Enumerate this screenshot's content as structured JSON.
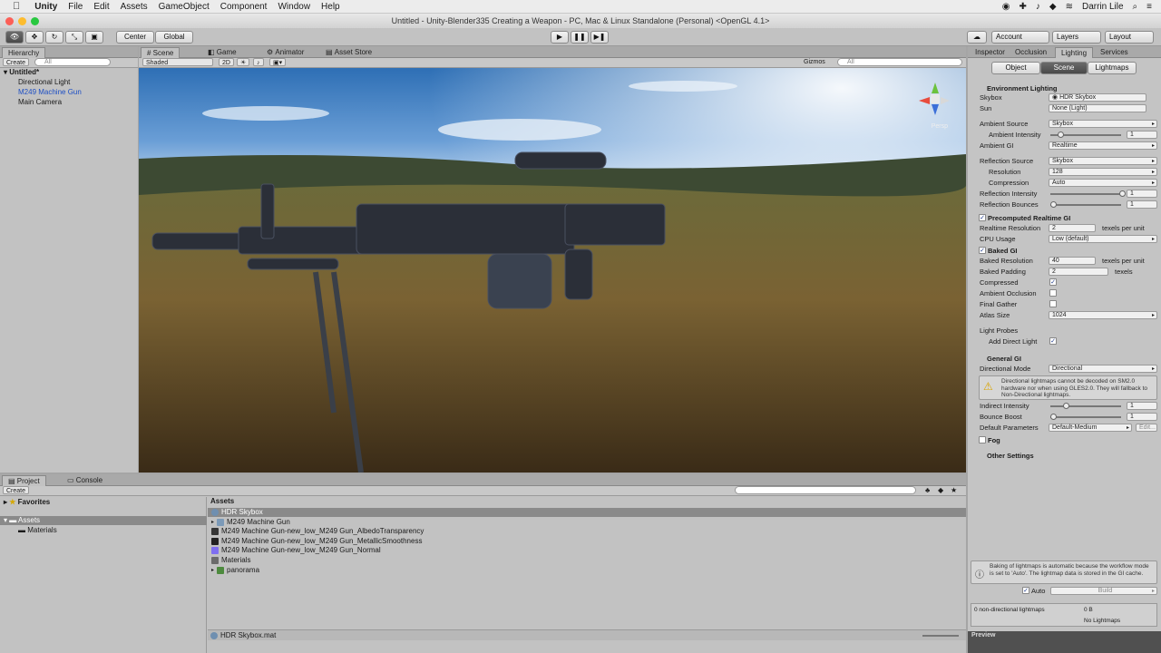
{
  "menubar": {
    "apple": "",
    "app": "Unity",
    "items": [
      "File",
      "Edit",
      "Assets",
      "GameObject",
      "Component",
      "Window",
      "Help"
    ],
    "user": "Darrin Lile"
  },
  "window": {
    "title": "Untitled - Unity-Blender335 Creating a Weapon - PC, Mac & Linux Standalone (Personal) <OpenGL 4.1>"
  },
  "toolbar": {
    "pivot": "Center",
    "space": "Global",
    "account": "Account",
    "layers": "Layers",
    "layout": "Layout"
  },
  "hierarchy": {
    "tab": "Hierarchy",
    "create": "Create",
    "search": "All",
    "scene_name": "Untitled*",
    "items": [
      "Directional Light",
      "M249 Machine Gun",
      "Main Camera"
    ]
  },
  "scene_view": {
    "tabs": [
      "Scene",
      "Game",
      "Animator",
      "Asset Store"
    ],
    "shading": "Shaded",
    "mode_2d": "2D",
    "gizmos": "Gizmos",
    "search": "All",
    "persp": "Persp"
  },
  "inspector": {
    "tabs": [
      "Inspector",
      "Occlusion",
      "Lighting",
      "Services"
    ],
    "subtabs": [
      "Object",
      "Scene",
      "Lightmaps"
    ],
    "env_header": "Environment Lighting",
    "skybox_label": "Skybox",
    "skybox_value": "HDR Skybox",
    "sun_label": "Sun",
    "sun_value": "None (Light)",
    "ambient_source_label": "Ambient Source",
    "ambient_source_value": "Skybox",
    "ambient_intensity_label": "Ambient Intensity",
    "ambient_intensity_value": "1",
    "ambient_gi_label": "Ambient GI",
    "ambient_gi_value": "Realtime",
    "refl_source_label": "Reflection Source",
    "refl_source_value": "Skybox",
    "resolution_label": "Resolution",
    "resolution_value": "128",
    "compression_label": "Compression",
    "compression_value": "Auto",
    "refl_intensity_label": "Reflection Intensity",
    "refl_intensity_value": "1",
    "refl_bounces_label": "Reflection Bounces",
    "refl_bounces_value": "1",
    "precomputed_header": "Precomputed Realtime GI",
    "rt_res_label": "Realtime Resolution",
    "rt_res_value": "2",
    "rt_res_unit": "texels per unit",
    "cpu_label": "CPU Usage",
    "cpu_value": "Low (default)",
    "baked_header": "Baked GI",
    "baked_res_label": "Baked Resolution",
    "baked_res_value": "40",
    "baked_res_unit": "texels per unit",
    "baked_pad_label": "Baked Padding",
    "baked_pad_value": "2",
    "baked_pad_unit": "texels",
    "compressed_label": "Compressed",
    "ao_label": "Ambient Occlusion",
    "final_gather_label": "Final Gather",
    "atlas_label": "Atlas Size",
    "atlas_value": "1024",
    "probes_label": "Light Probes",
    "direct_light_label": "Add Direct Light",
    "general_header": "General GI",
    "dir_mode_label": "Directional Mode",
    "dir_mode_value": "Directional",
    "warning": "Directional lightmaps cannot be decoded on SM2.0 hardware nor when using GLES2.0. They will fallback to Non-Directional lightmaps.",
    "indirect_label": "Indirect Intensity",
    "indirect_value": "1",
    "bounce_label": "Bounce Boost",
    "bounce_value": "1",
    "default_params_label": "Default Parameters",
    "default_params_value": "Default-Medium",
    "edit": "Edit...",
    "fog_label": "Fog",
    "other_settings": "Other Settings",
    "info": "Baking of lightmaps is automatic because the workflow mode is set to 'Auto'. The lightmap data is stored in the GI cache.",
    "auto_label": "Auto",
    "build_label": "Build",
    "lightmaps_count": "0 non-directional lightmaps",
    "lightmaps_size": "0 B",
    "no_lightmaps": "No Lightmaps",
    "preview": "Preview"
  },
  "project": {
    "tabs": [
      "Project",
      "Console"
    ],
    "create": "Create",
    "favorites": "Favorites",
    "assets_root": "Assets",
    "materials_folder": "Materials",
    "breadcrumb": "Assets",
    "assets": [
      "HDR Skybox",
      "M249 Machine Gun",
      "M249 Machine Gun-new_low_M249 Gun_AlbedoTransparency",
      "M249 Machine Gun-new_low_M249 Gun_MetallicSmoothness",
      "M249 Machine Gun-new_low_M249 Gun_Normal",
      "Materials",
      "panorama"
    ],
    "selected_file": "HDR Skybox.mat"
  }
}
